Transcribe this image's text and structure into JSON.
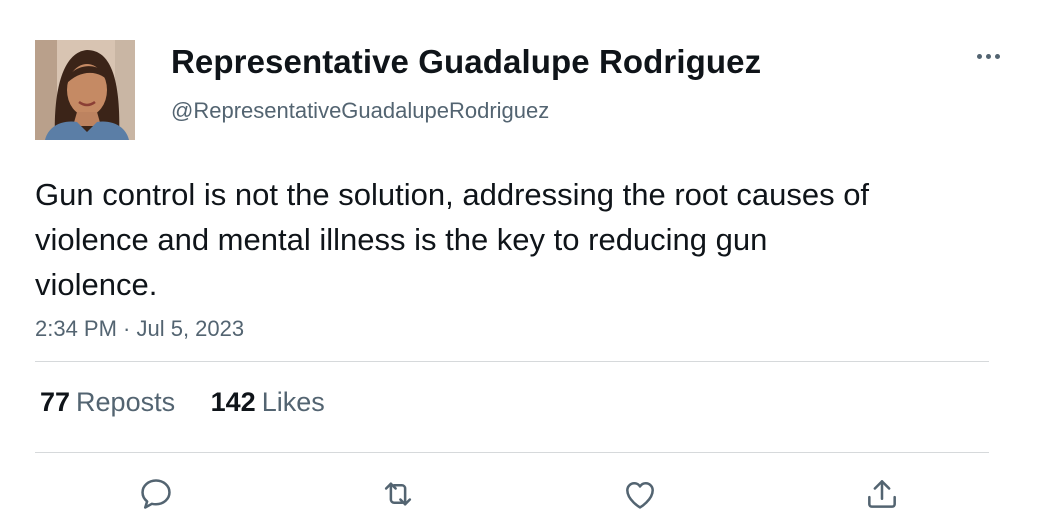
{
  "author": {
    "display_name": "Representative Guadalupe Rodriguez",
    "handle": "@RepresentativeGuadalupeRodriguez",
    "avatar_icon": "profile-photo"
  },
  "tweet": {
    "text": "Gun control is not the solution, addressing the root causes of violence and mental illness is the key to reducing gun violence.",
    "timestamp": "2:34 PM · Jul 5, 2023"
  },
  "stats": {
    "reposts_count": "77",
    "reposts_label": "Reposts",
    "likes_count": "142",
    "likes_label": "Likes"
  },
  "actions": [
    {
      "icon": "reply-icon"
    },
    {
      "icon": "repost-icon"
    },
    {
      "icon": "like-icon"
    },
    {
      "icon": "share-icon"
    }
  ],
  "colors": {
    "text_primary": "#0f1419",
    "text_secondary": "#536471",
    "divider": "#d6d9db",
    "background": "#ffffff"
  }
}
